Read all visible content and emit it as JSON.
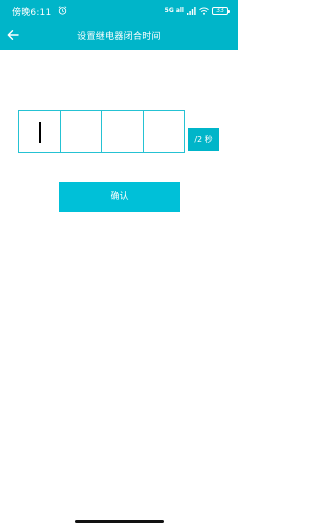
{
  "statusbar": {
    "time": "傍晚6:11",
    "network": "5G all",
    "battery": "33",
    "icons": [
      "alarm-icon",
      "signal-icon",
      "wifi-icon",
      "battery-icon"
    ]
  },
  "appbar": {
    "title": "设置继电器闭合时间",
    "back_icon": "arrow-left-icon"
  },
  "code_input": {
    "digits": [
      "",
      "",
      "",
      ""
    ],
    "cursor_position": 1
  },
  "unit_badge": {
    "label": "/2 秒"
  },
  "confirm_button": {
    "label": "确认"
  },
  "colors": {
    "accent": "#00b5c9",
    "button": "#00c0d8",
    "border": "#25c2d3",
    "background": "#ffffff"
  }
}
